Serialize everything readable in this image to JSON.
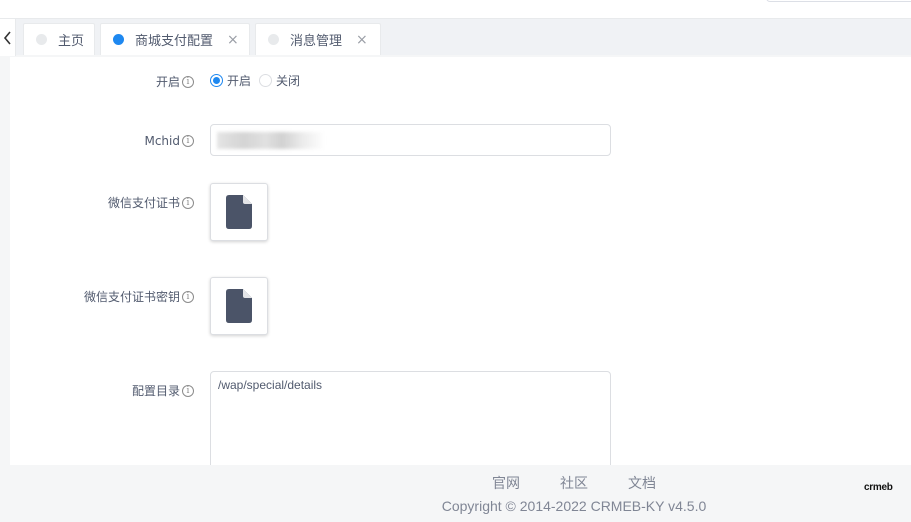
{
  "tabs": {
    "items": [
      {
        "label": "主页"
      },
      {
        "label": "商城支付配置"
      },
      {
        "label": "消息管理"
      }
    ],
    "close_glyph": "×"
  },
  "form": {
    "open": {
      "label": "开启",
      "options": [
        "开启",
        "关闭"
      ],
      "selected": "开启"
    },
    "mchid": {
      "label": "Mchid",
      "value": ""
    },
    "cert": {
      "label": "微信支付证书",
      "icon": "file-icon"
    },
    "cert_key": {
      "label": "微信支付证书密钥",
      "icon": "file-icon"
    },
    "config_dir": {
      "label": "配置目录",
      "value": "/wap/special/details"
    }
  },
  "footer": {
    "links": [
      "官网",
      "社区",
      "文档"
    ],
    "copyright": "Copyright © 2014-2022 CRMEB-KY v4.5.0",
    "logo_text": "crmeb"
  },
  "colors": {
    "accent": "#1e88f0",
    "file_icon": "#4b5468"
  }
}
